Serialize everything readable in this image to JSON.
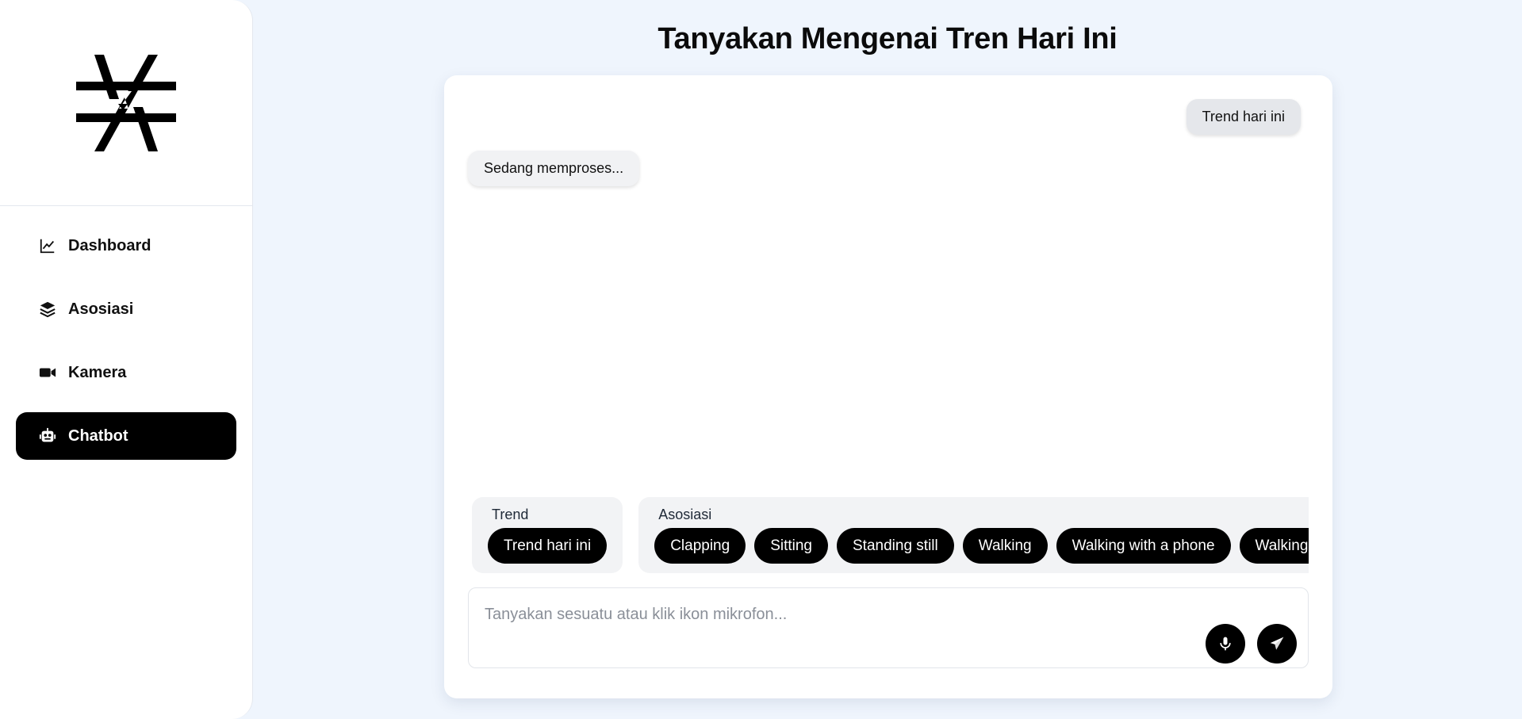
{
  "sidebar": {
    "items": [
      {
        "label": "Dashboard",
        "icon": "line-chart-icon"
      },
      {
        "label": "Asosiasi",
        "icon": "layers-icon"
      },
      {
        "label": "Kamera",
        "icon": "video-camera-icon"
      },
      {
        "label": "Chatbot",
        "icon": "robot-icon",
        "active": true
      }
    ]
  },
  "main": {
    "title": "Tanyakan Mengenai Tren Hari Ini"
  },
  "chat": {
    "messages": [
      {
        "role": "user",
        "text": "Trend hari ini"
      },
      {
        "role": "bot",
        "text": "Sedang memproses..."
      }
    ],
    "suggestions": {
      "trend": {
        "label": "Trend",
        "chips": [
          "Trend hari ini"
        ]
      },
      "asosiasi": {
        "label": "Asosiasi",
        "chips": [
          "Clapping",
          "Sitting",
          "Standing still",
          "Walking",
          "Walking with a phone",
          "Walking w"
        ]
      }
    },
    "input": {
      "placeholder": "Tanyakan sesuatu atau klik ikon mikrofon...",
      "value": ""
    }
  },
  "colors": {
    "background": "#eff5fd",
    "active_nav": "#000000",
    "chip": "#000000"
  }
}
